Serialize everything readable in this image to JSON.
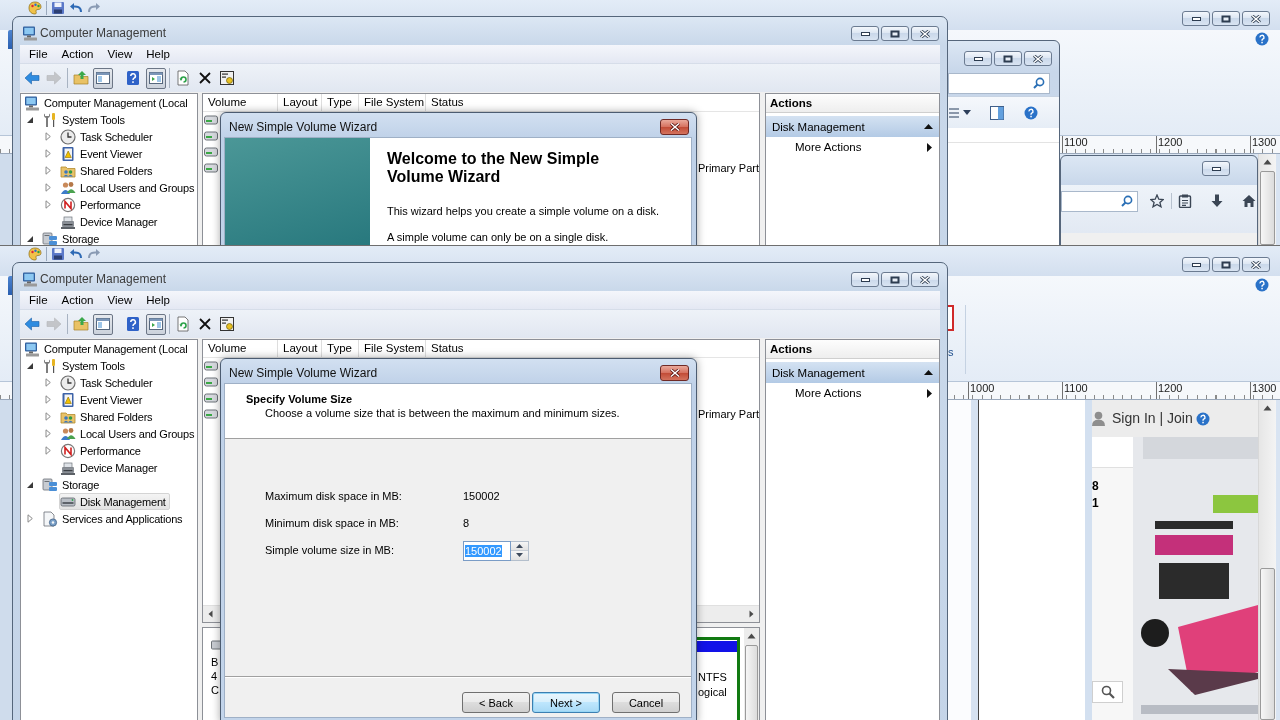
{
  "screens": [
    {
      "paint": {
        "ruler": [
          "1100",
          "1200",
          "1300"
        ]
      },
      "back_windows": [
        {
          "kind": "explorer"
        },
        {
          "kind": "browser"
        }
      ],
      "window": {
        "title": "Computer Management",
        "menu": [
          "File",
          "Action",
          "View",
          "Help"
        ],
        "toolbar": [
          [
            {
              "kind": "back",
              "disabled": false,
              "pressed": false
            },
            {
              "kind": "forward",
              "disabled": true,
              "pressed": false
            }
          ],
          [
            {
              "kind": "up",
              "disabled": false,
              "pressed": false
            },
            {
              "kind": "tree",
              "disabled": false,
              "pressed": true
            },
            {
              "kind": "help",
              "disabled": false,
              "pressed": false
            },
            {
              "kind": "action-pane",
              "disabled": false,
              "pressed": true
            }
          ],
          [
            {
              "kind": "refresh",
              "disabled": false,
              "pressed": false
            },
            {
              "kind": "delete",
              "disabled": false,
              "pressed": false
            },
            {
              "kind": "properties",
              "disabled": false,
              "pressed": false
            }
          ]
        ],
        "tree": [
          {
            "label": "Computer Management (Local",
            "kind": "computer",
            "selected": false,
            "children": [
              {
                "label": "System Tools",
                "kind": "tools",
                "expanded": true,
                "selected": false,
                "children": [
                  {
                    "label": "Task Scheduler",
                    "kind": "scheduler",
                    "expanded": false,
                    "selected": false
                  },
                  {
                    "label": "Event Viewer",
                    "kind": "events",
                    "expanded": false,
                    "selected": false
                  },
                  {
                    "label": "Shared Folders",
                    "kind": "shared",
                    "expanded": false,
                    "selected": false
                  },
                  {
                    "label": "Local Users and Groups",
                    "kind": "users",
                    "expanded": false,
                    "selected": false
                  },
                  {
                    "label": "Performance",
                    "kind": "performance",
                    "expanded": false,
                    "selected": false
                  },
                  {
                    "label": "Device Manager",
                    "kind": "devices",
                    "selected": false
                  }
                ]
              },
              {
                "label": "Storage",
                "kind": "storage",
                "expanded": true,
                "selected": false
              }
            ]
          }
        ],
        "columns": [
          "Volume",
          "Layout",
          "Type",
          "File System",
          "Status"
        ],
        "rows": [
          {
            "kind": "volume"
          },
          {
            "kind": "volume"
          },
          {
            "kind": "volume"
          },
          {
            "kind": "volume",
            "text": "Primary Part"
          }
        ],
        "actions": {
          "title": "Actions",
          "groups": [
            {
              "label": "Disk Management",
              "expanded": true,
              "items": [
                "More Actions"
              ]
            }
          ]
        },
        "wizard": {
          "title": "New Simple Volume Wizard",
          "kind": "welcome",
          "heading": "Welcome to the New Simple Volume Wizard",
          "paragraphs": [
            "This wizard helps you create a simple volume on a disk.",
            "A simple volume can only be on a single disk."
          ]
        }
      }
    },
    {
      "paint": {
        "ruler": [
          "1000",
          "1100",
          "1200",
          "1300"
        ],
        "ribbon_text": "s",
        "page": {
          "links": "Sign In | Join",
          "cut_text": [
            "8",
            "1"
          ]
        }
      },
      "window": {
        "title": "Computer Management",
        "menu": [
          "File",
          "Action",
          "View",
          "Help"
        ],
        "toolbar": [
          [
            {
              "kind": "back",
              "disabled": false,
              "pressed": false
            },
            {
              "kind": "forward",
              "disabled": true,
              "pressed": false
            }
          ],
          [
            {
              "kind": "up",
              "disabled": false,
              "pressed": false
            },
            {
              "kind": "tree",
              "disabled": false,
              "pressed": true
            },
            {
              "kind": "help",
              "disabled": false,
              "pressed": false
            },
            {
              "kind": "action-pane",
              "disabled": false,
              "pressed": true
            }
          ],
          [
            {
              "kind": "refresh",
              "disabled": false,
              "pressed": false
            },
            {
              "kind": "delete",
              "disabled": false,
              "pressed": false
            },
            {
              "kind": "properties",
              "disabled": false,
              "pressed": false
            }
          ]
        ],
        "tree": [
          {
            "label": "Computer Management (Local",
            "kind": "computer",
            "selected": false,
            "children": [
              {
                "label": "System Tools",
                "kind": "tools",
                "expanded": true,
                "selected": false,
                "children": [
                  {
                    "label": "Task Scheduler",
                    "kind": "scheduler",
                    "expanded": false,
                    "selected": false
                  },
                  {
                    "label": "Event Viewer",
                    "kind": "events",
                    "expanded": false,
                    "selected": false
                  },
                  {
                    "label": "Shared Folders",
                    "kind": "shared",
                    "expanded": false,
                    "selected": false
                  },
                  {
                    "label": "Local Users and Groups",
                    "kind": "users",
                    "expanded": false,
                    "selected": false
                  },
                  {
                    "label": "Performance",
                    "kind": "performance",
                    "expanded": false,
                    "selected": false
                  },
                  {
                    "label": "Device Manager",
                    "kind": "devices",
                    "selected": false
                  }
                ]
              },
              {
                "label": "Storage",
                "kind": "storage",
                "expanded": true,
                "selected": false,
                "children": [
                  {
                    "label": "Disk Management",
                    "kind": "disk",
                    "selected": true
                  }
                ]
              },
              {
                "label": "Services and Applications",
                "kind": "services",
                "expanded": false,
                "selected": false
              }
            ]
          }
        ],
        "columns": [
          "Volume",
          "Layout",
          "Type",
          "File System",
          "Status"
        ],
        "rows": [
          {
            "kind": "volume"
          },
          {
            "kind": "volume"
          },
          {
            "kind": "volume"
          },
          {
            "kind": "volume",
            "text": "Primary Part"
          }
        ],
        "disk_map": {
          "disk_lines": [
            "B",
            "4",
            "C"
          ],
          "partition_lines": [
            "NTFS",
            "ogical"
          ]
        },
        "actions": {
          "title": "Actions",
          "groups": [
            {
              "label": "Disk Management",
              "expanded": true,
              "items": [
                "More Actions"
              ]
            }
          ]
        },
        "wizard": {
          "title": "New Simple Volume Wizard",
          "kind": "size",
          "heading": "Specify Volume Size",
          "subheading": "Choose a volume size that is between the maximum and minimum sizes.",
          "fields": [
            {
              "kind": "readout",
              "label": "Maximum disk space in MB:",
              "value": "150002"
            },
            {
              "kind": "readout",
              "label": "Minimum disk space in MB:",
              "value": "8"
            },
            {
              "kind": "spin",
              "label": "Simple volume size in MB:",
              "value": "150002",
              "highlighted": true
            }
          ],
          "buttons": [
            {
              "label": "< Back",
              "default": false
            },
            {
              "label": "Next >",
              "default": true
            },
            {
              "label": "Cancel",
              "default": false
            }
          ]
        }
      }
    }
  ]
}
